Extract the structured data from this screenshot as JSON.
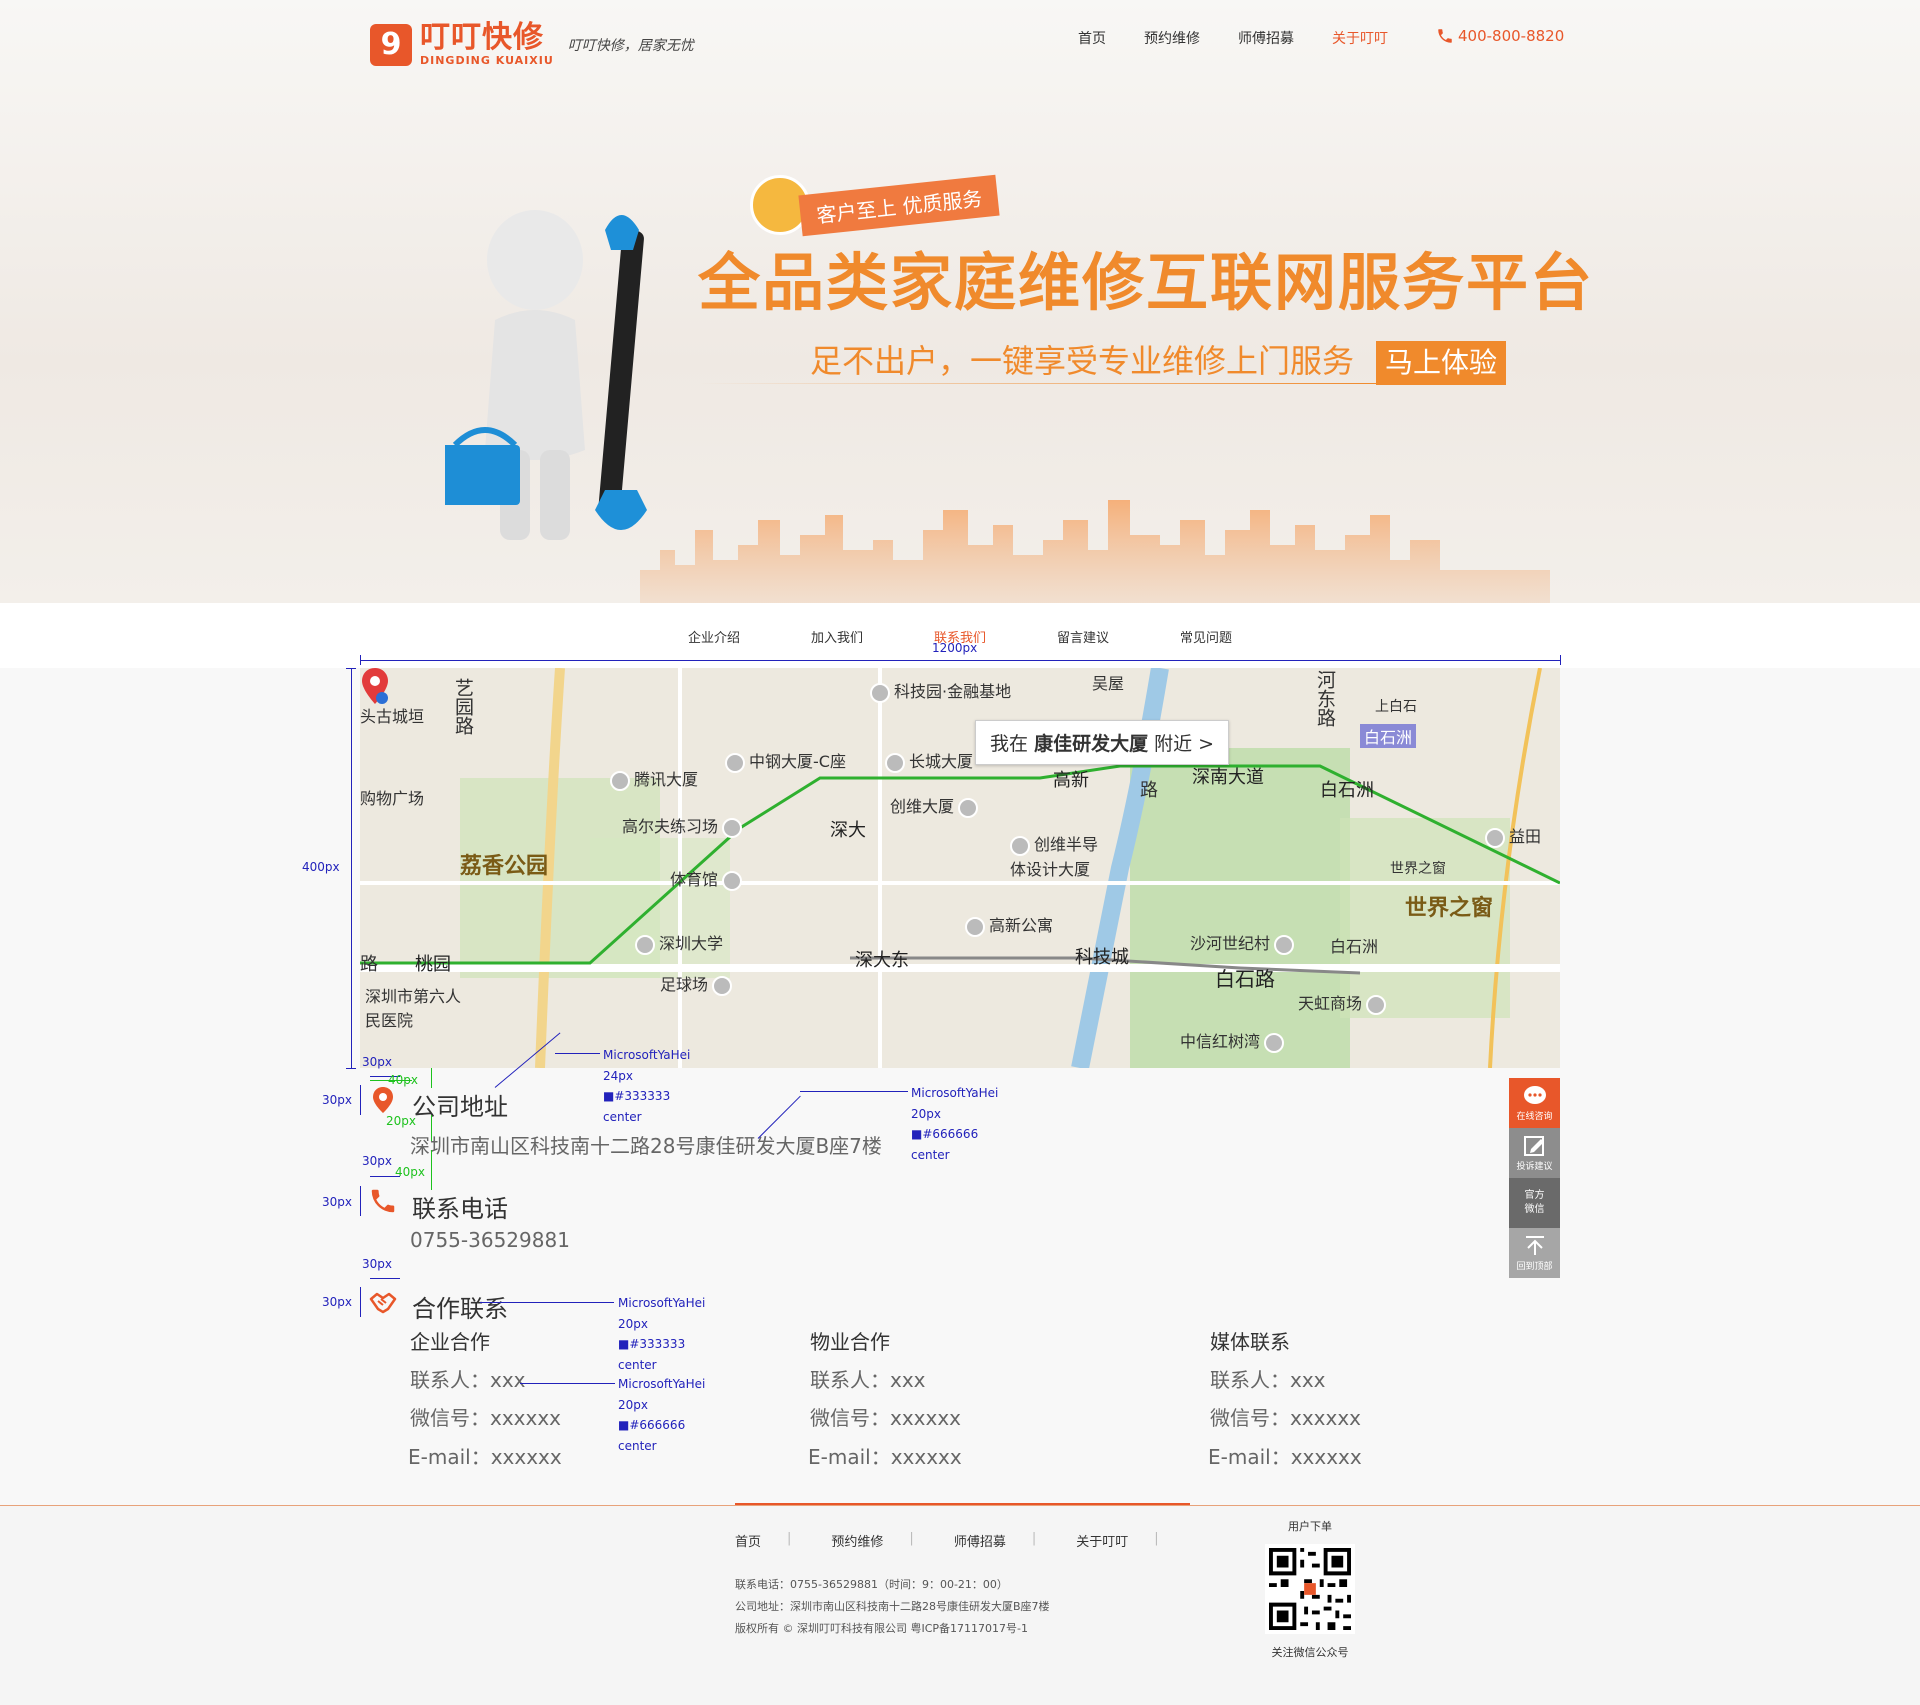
{
  "header": {
    "logo_mark": "9",
    "logo_cn": "叮叮快修",
    "logo_en": "DINGDING KUAIXIU",
    "slogan": "叮叮快修，居家无忧",
    "nav": [
      {
        "label": "首页",
        "active": false
      },
      {
        "label": "预约维修",
        "active": false
      },
      {
        "label": "师傅招募",
        "active": false
      },
      {
        "label": "关于叮叮",
        "active": true
      }
    ],
    "hotline": "400-800-8820"
  },
  "banner": {
    "badge": "客户至上  优质服务",
    "title": "全品类家庭维修互联网服务平台",
    "subtitle": "足不出户，一键享受专业维修上门服务",
    "cta": "马上体验"
  },
  "subnav": {
    "items": [
      {
        "label": "企业介绍",
        "active": false
      },
      {
        "label": "加入我们",
        "active": false
      },
      {
        "label": "联系我们",
        "active": true
      },
      {
        "label": "留言建议",
        "active": false
      },
      {
        "label": "常见问题",
        "active": false
      }
    ]
  },
  "annotations": {
    "width_1200": "1200px",
    "height_400": "400px",
    "w30": "30px",
    "h30": "30px",
    "g40": "40px",
    "g20": "20px",
    "title_font": [
      "MicrosoftYaHei",
      "24px",
      "■#333333",
      "center"
    ],
    "text_font": [
      "MicrosoftYaHei",
      "20px",
      "■#666666",
      "center"
    ],
    "coop_title_font": [
      "MicrosoftYaHei",
      "20px",
      "■#333333",
      "center"
    ],
    "coop_text_font": [
      "MicrosoftYaHei",
      "20px",
      "■#666666",
      "center"
    ]
  },
  "map": {
    "popup_prefix": "我在",
    "popup_place": "康佳研发大厦",
    "popup_suffix": "附近 >",
    "labels": [
      "头古城垣",
      "艺园路",
      "科技园·金融基地",
      "吴屋",
      "白石洲",
      "河东路",
      "上白石",
      "腾讯大厦",
      "中钢大厦-C座",
      "长城大厦",
      "高新",
      "深南大道",
      "白石洲",
      "购物广场",
      "高尔夫练习场",
      "创维大厦",
      "深大",
      "荔香公园",
      "创维半导体设计大厦",
      "益田",
      "体育馆",
      "世界之窗",
      "世界之窗",
      "高新公寓",
      "深圳大学",
      "深大东",
      "科技城",
      "沙河世纪村",
      "白石洲",
      "桃园",
      "足球场",
      "白石路",
      "天虹商场",
      "深圳市第六人民医院",
      "中信红树湾",
      "路",
      "路"
    ]
  },
  "contact": {
    "address_title": "公司地址",
    "address": "深圳市南山区科技南十二路28号康佳研发大厦B座7楼",
    "phone_title": "联系电话",
    "phone": "0755-36529881",
    "coop_title": "合作联系",
    "columns": [
      {
        "title": "企业合作",
        "contact": "联系人：xxx",
        "wechat": "微信号：xxxxxx",
        "email": "E-mail：xxxxxx"
      },
      {
        "title": "物业合作",
        "contact": "联系人：xxx",
        "wechat": "微信号：xxxxxx",
        "email": "E-mail：xxxxxx"
      },
      {
        "title": "媒体联系",
        "contact": "联系人：xxx",
        "wechat": "微信号：xxxxxx",
        "email": "E-mail：xxxxxx"
      }
    ]
  },
  "sidebar": {
    "items": [
      "在线咨询",
      "投诉建议",
      "官方微信",
      "回到顶部"
    ],
    "wechat_l1": "官方",
    "wechat_l2": "微信"
  },
  "footer": {
    "nav": [
      "首页",
      "预约维修",
      "师傅招募",
      "关于叮叮"
    ],
    "phone_line": "联系电话：0755-36529881（时间：9：00-21：00）",
    "address_line": "公司地址：深圳市南山区科技南十二路28号康佳研发大厦B座7楼",
    "copyright_line": "版权所有 ©    深圳叮叮科技有限公司  粤ICP备17117017号-1",
    "qr_title": "用户下单",
    "qr_caption": "关注微信公众号"
  },
  "colors": {
    "brand": "#e8572a",
    "banner_orange": "#f08a2c",
    "annotation_blue": "#2222bb",
    "annotation_green": "#1ec21e",
    "metro_green": "#2fb02f"
  }
}
